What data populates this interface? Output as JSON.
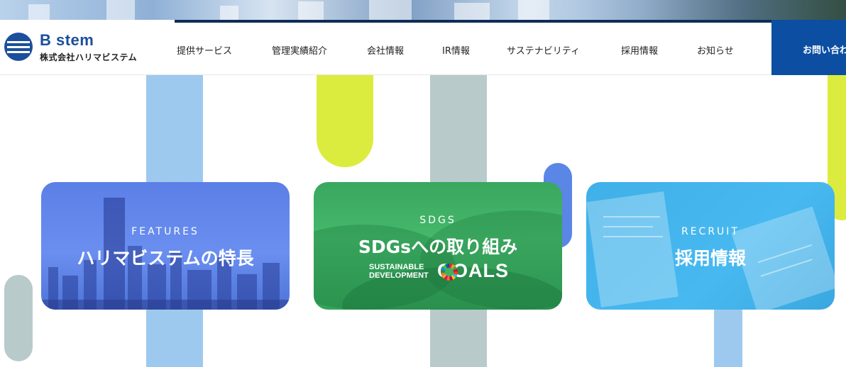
{
  "header": {
    "logo_wordmark": "B stem",
    "logo_company": "株式会社ハリマビステム",
    "nav": [
      {
        "label": "提供サービス"
      },
      {
        "label": "管理実績紹介"
      },
      {
        "label": "会社情報"
      },
      {
        "label": "IR情報"
      },
      {
        "label": "サステナビリティ"
      },
      {
        "label": "採用情報"
      },
      {
        "label": "お知らせ"
      }
    ],
    "contact_label": "お問い合わせ"
  },
  "cards": {
    "features": {
      "label_en": "FEATURES",
      "label_ja": "ハリマビステムの特長"
    },
    "sdgs": {
      "label_en": "SDGS",
      "label_ja": "SDGsへの取り組み",
      "goals_small_line1": "SUSTAINABLE",
      "goals_small_line2": "DEVELOPMENT",
      "goals_big": "GOALS"
    },
    "recruit": {
      "label_en": "RECRUIT",
      "label_ja": "採用情報"
    }
  },
  "colors": {
    "brand_blue": "#0b4ea2",
    "lime": "#dcec3f",
    "sky": "#9ec9ee",
    "gray": "#b9caca"
  }
}
